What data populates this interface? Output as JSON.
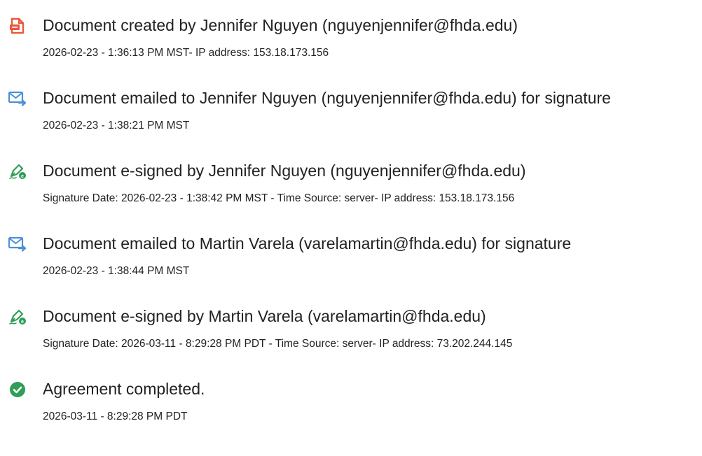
{
  "events": [
    {
      "icon": "document-created-icon",
      "title": "Document created by Jennifer Nguyen (nguyenjennifer@fhda.edu)",
      "detail": "2026-02-23 - 1:36:13 PM MST- IP address: 153.18.173.156"
    },
    {
      "icon": "email-sent-icon",
      "title": "Document emailed to Jennifer Nguyen (nguyenjennifer@fhda.edu) for signature",
      "detail": "2026-02-23 - 1:38:21 PM MST"
    },
    {
      "icon": "esign-pen-icon",
      "title": "Document e-signed by Jennifer Nguyen (nguyenjennifer@fhda.edu)",
      "detail": "Signature Date: 2026-02-23 - 1:38:42 PM MST - Time Source: server- IP address: 153.18.173.156"
    },
    {
      "icon": "email-sent-icon",
      "title": "Document emailed to Martin Varela (varelamartin@fhda.edu) for signature",
      "detail": "2026-02-23 - 1:38:44 PM MST"
    },
    {
      "icon": "esign-pen-icon",
      "title": "Document e-signed by Martin Varela (varelamartin@fhda.edu)",
      "detail": "Signature Date: 2026-03-11 - 8:29:28 PM PDT - Time Source: server- IP address: 73.202.244.145"
    },
    {
      "icon": "completed-check-icon",
      "title": "Agreement completed.",
      "detail": "2026-03-11 - 8:29:28 PM PDT"
    }
  ],
  "colors": {
    "created_icon": "#e8583a",
    "email_icon": "#4a90d9",
    "esign_icon": "#2f9e57",
    "completed_icon": "#2f9e57",
    "text": "#222222"
  }
}
